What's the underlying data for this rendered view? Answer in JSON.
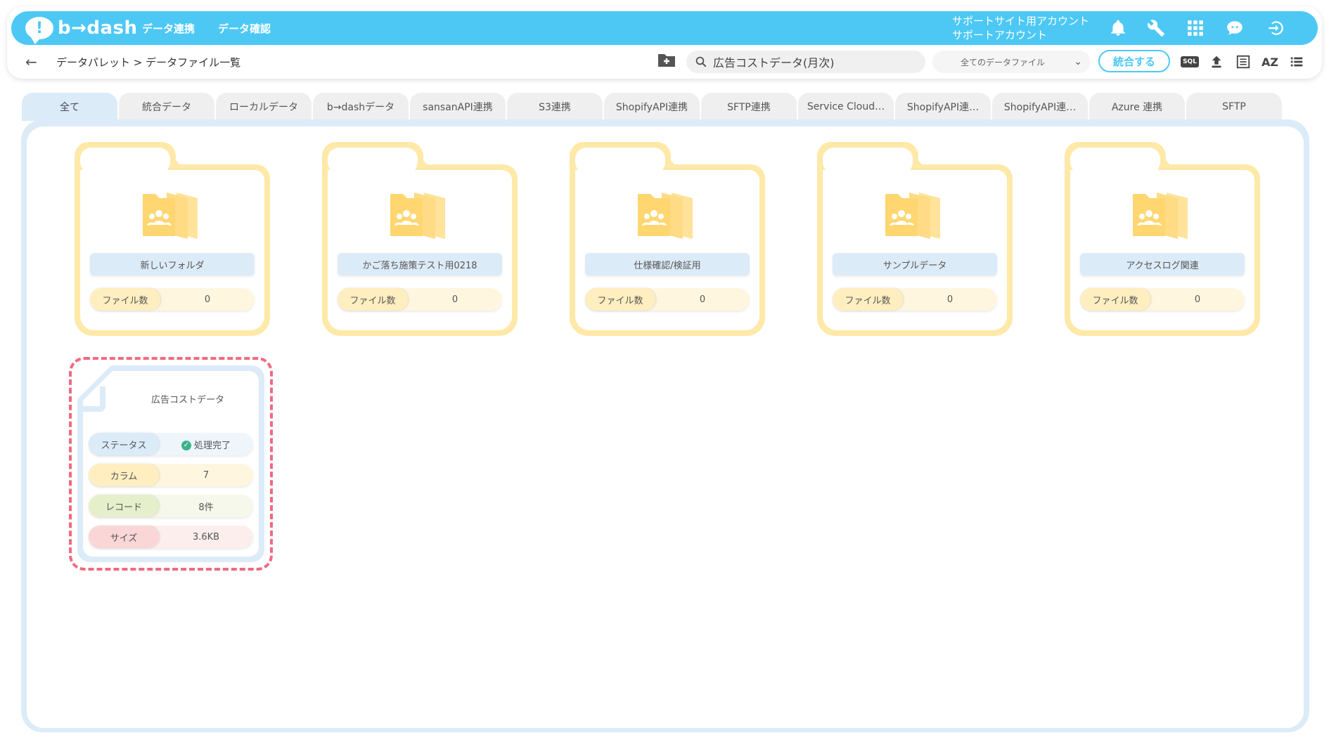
{
  "header": {
    "logo_mark": "!",
    "logo_text": "b→dash",
    "nav": [
      "データ連携",
      "データ確認"
    ],
    "account_line1": "サポートサイト用アカウント",
    "account_line2": "サポートアカウント"
  },
  "toolbar": {
    "back_arrow": "←",
    "breadcrumb": "データパレット > データファイル一覧",
    "search_value": "広告コストデータ(月次)",
    "filter_selected": "全てのデータファイル",
    "filter_chevron": "⌄",
    "merge_label": "統合する",
    "sql_label": "SQL",
    "az_label": "AZ"
  },
  "tabs": [
    "全て",
    "統合データ",
    "ローカルデータ",
    "b→dashデータ",
    "sansanAPI連携",
    "S3連携",
    "ShopifyAPI連携",
    "SFTP連携",
    "Service Cloud…",
    "ShopifyAPI連…",
    "ShopifyAPI連…",
    "Azure 連携",
    "SFTP"
  ],
  "active_tab": 0,
  "folders": [
    {
      "name": "新しいフォルダ",
      "count_label": "ファイル数",
      "count": "0"
    },
    {
      "name": "かご落ち施策テスト用0218",
      "count_label": "ファイル数",
      "count": "0"
    },
    {
      "name": "仕様確認/検証用",
      "count_label": "ファイル数",
      "count": "0"
    },
    {
      "name": "サンプルデータ",
      "count_label": "ファイル数",
      "count": "0"
    },
    {
      "name": "アクセスログ関連",
      "count_label": "ファイル数",
      "count": "0"
    }
  ],
  "file": {
    "title": "広告コストデータ",
    "status_label": "ステータス",
    "status_value": "処理完了",
    "status_check": "✓",
    "column_label": "カラム",
    "column_value": "7",
    "record_label": "レコード",
    "record_value": "8件",
    "size_label": "サイズ",
    "size_value": "3.6KB"
  },
  "colors": {
    "brand": "#4dc8f5",
    "folder": "#ffe9a8",
    "panel": "#dcebf8",
    "highlight": "#f06a80",
    "status_ok": "#3cb38a"
  }
}
